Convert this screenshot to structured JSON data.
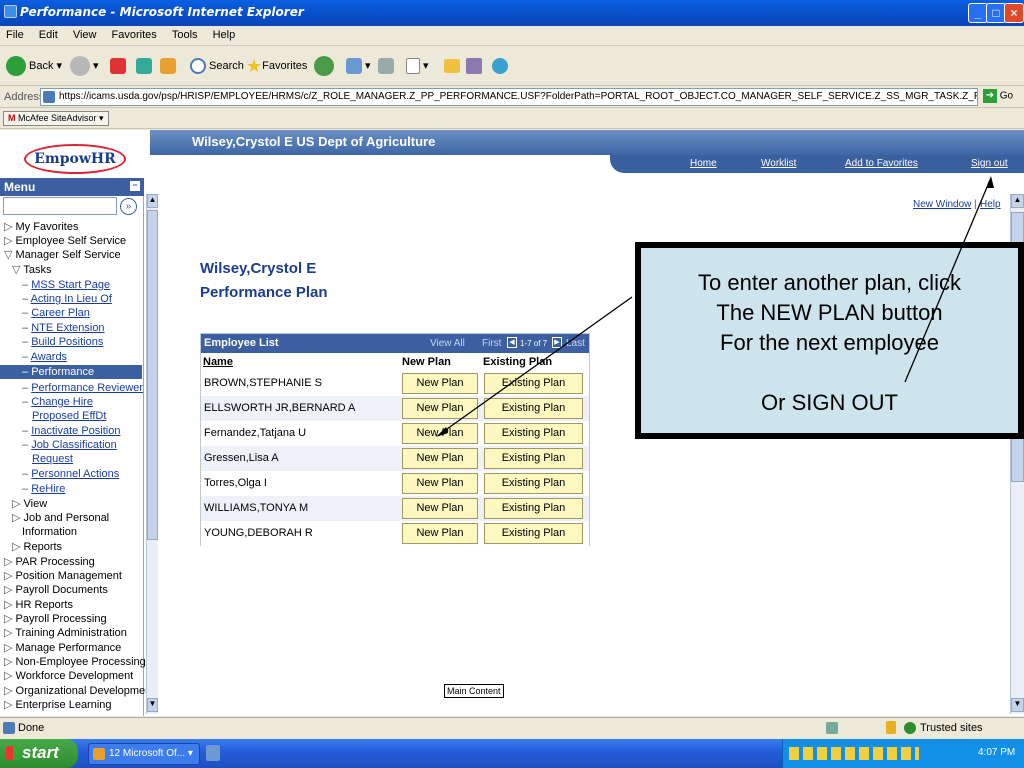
{
  "window": {
    "title": "Performance - Microsoft Internet Explorer"
  },
  "menubar": [
    "File",
    "Edit",
    "View",
    "Favorites",
    "Tools",
    "Help"
  ],
  "toolbar": {
    "back": "Back",
    "search": "Search",
    "favorites": "Favorites"
  },
  "address": {
    "label": "Address",
    "url": "https://icams.usda.gov/psp/HRISP/EMPLOYEE/HRMS/c/Z_ROLE_MANAGER.Z_PP_PERFORMANCE.USF?FolderPath=PORTAL_ROOT_OBJECT.CO_MANAGER_SELF_SERVICE.Z_SS_MGR_TASK.Z_PP_PERFORMANCE_USF_1&IsFolder=false",
    "go": "Go"
  },
  "mcafee": {
    "label": "McAfee SiteAdvisor"
  },
  "header": {
    "logo": "EmpowHR",
    "user_org": "Wilsey,Crystol E  US Dept of Agriculture",
    "nav": {
      "home": "Home",
      "worklist": "Worklist",
      "add_favorites": "Add to Favorites",
      "sign_out": "Sign out"
    }
  },
  "menu": {
    "title": "Menu",
    "search_go": "»",
    "items": [
      {
        "label": "My Favorites"
      },
      {
        "label": "Employee Self Service"
      },
      {
        "label": "Manager Self Service"
      },
      {
        "label": "Tasks"
      },
      {
        "label": "MSS Start Page"
      },
      {
        "label": "Acting In Lieu Of"
      },
      {
        "label": "Career Plan"
      },
      {
        "label": "NTE Extension"
      },
      {
        "label": "Build Positions"
      },
      {
        "label": "Awards"
      },
      {
        "label": "Performance"
      },
      {
        "label": "Performance Reviewer"
      },
      {
        "label": "Change Hire Proposed EffDt"
      },
      {
        "label": "Inactivate Position"
      },
      {
        "label": "Job Classification Request"
      },
      {
        "label": "Personnel Actions"
      },
      {
        "label": "ReHire"
      },
      {
        "label": "View"
      },
      {
        "label": "Job and Personal Information"
      },
      {
        "label": "Reports"
      },
      {
        "label": "PAR Processing"
      },
      {
        "label": "Position Management"
      },
      {
        "label": "Payroll Documents"
      },
      {
        "label": "HR Reports"
      },
      {
        "label": "Payroll Processing"
      },
      {
        "label": "Training Administration"
      },
      {
        "label": "Manage Performance"
      },
      {
        "label": "Non-Employee Processing"
      },
      {
        "label": "Workforce Development"
      },
      {
        "label": "Organizational Development"
      },
      {
        "label": "Enterprise Learning"
      }
    ]
  },
  "content": {
    "new_window": "New Window",
    "help": "Help",
    "employee_name": "Wilsey,Crystol E",
    "page_title": "Performance Plan",
    "grid": {
      "title": "Employee List",
      "view_all": "View All",
      "first": "First",
      "range": "1-7 of 7",
      "last": "Last",
      "col_name": "Name",
      "col_new": "New Plan",
      "col_existing": "Existing Plan",
      "new_btn": "New Plan",
      "existing_btn": "Existing Plan",
      "rows": [
        "BROWN,STEPHANIE S",
        "ELLSWORTH JR,BERNARD A",
        "Fernandez,Tatjana U",
        "Gressen,Lisa A",
        "Torres,Olga I",
        "WILLIAMS,TONYA M",
        "YOUNG,DEBORAH R"
      ]
    },
    "main_content": "Main Content"
  },
  "callout": {
    "line1": "To enter another plan, click",
    "line2": "The NEW PLAN button",
    "line3": "For the next employee",
    "line4": "Or SIGN OUT"
  },
  "status": {
    "left": "Done",
    "zone": "Trusted sites"
  },
  "taskbar": {
    "start": "start",
    "task": "12 Microsoft Of...",
    "clock": "4:07 PM"
  }
}
